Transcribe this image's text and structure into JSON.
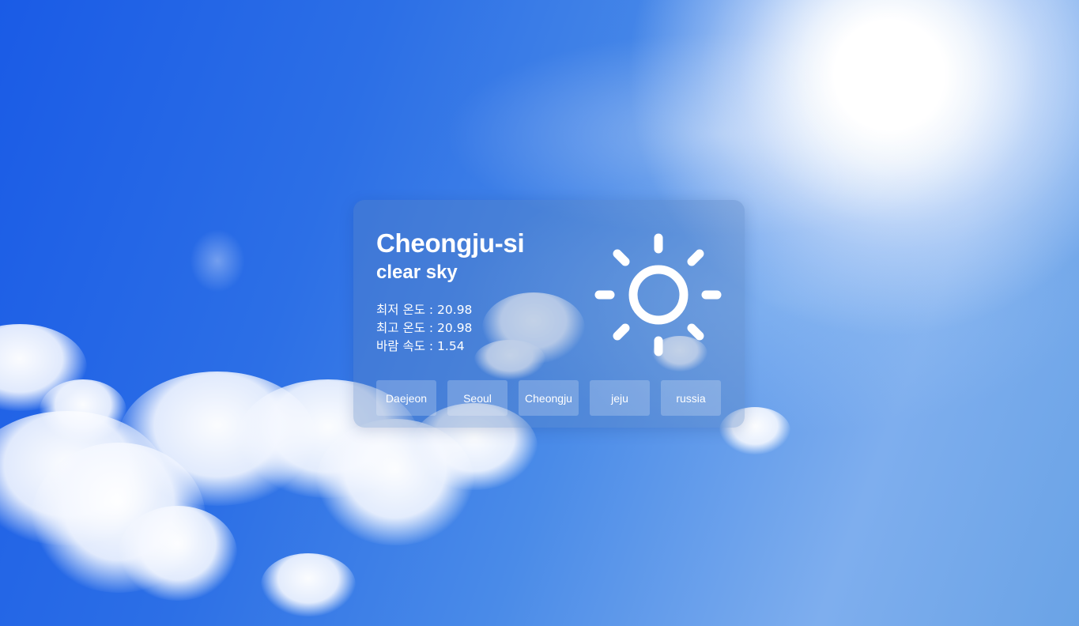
{
  "weather": {
    "city": "Cheongju-si",
    "description": "clear sky",
    "icon": "sun-icon",
    "stats": [
      {
        "label": "최저 온도 : ",
        "value": "20.98"
      },
      {
        "label": "최고 온도 : ",
        "value": "20.98"
      },
      {
        "label": "바람 속도 : ",
        "value": "1.54"
      }
    ]
  },
  "cities": [
    "Daejeon",
    "Seoul",
    "Cheongju",
    "jeju",
    "russia"
  ],
  "colors": {
    "sky": "#2c6fe6",
    "card": "#5a82be",
    "text": "#ffffff"
  }
}
